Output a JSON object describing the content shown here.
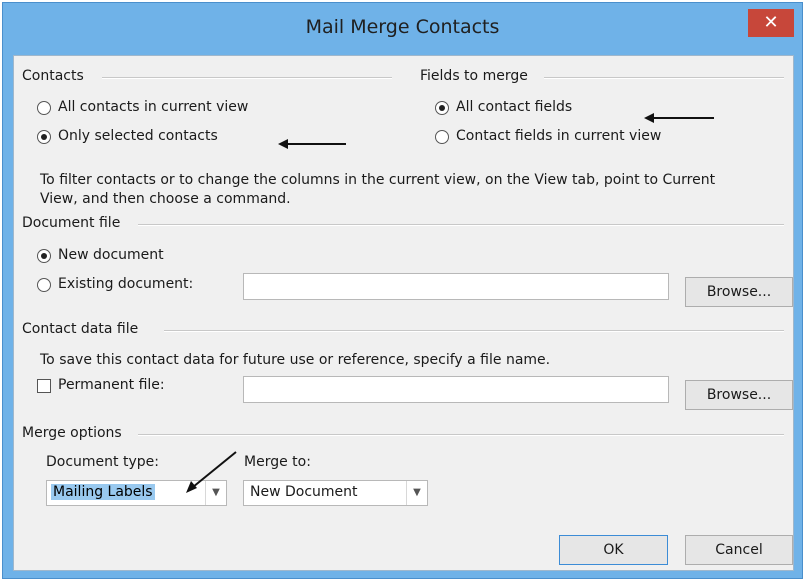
{
  "window": {
    "title": "Mail Merge Contacts",
    "close_label": "✕"
  },
  "contacts": {
    "label": "Contacts",
    "option_all": "All contacts in current view",
    "option_selected": "Only selected contacts",
    "selected": "selected"
  },
  "fields": {
    "label": "Fields to merge",
    "option_all": "All contact fields",
    "option_current": "Contact fields in current view",
    "selected": "all"
  },
  "help_text": {
    "line1": "To filter contacts or to change the columns in the current view, on the View tab, point to Current",
    "line2": "View, and then choose a command."
  },
  "document_file": {
    "label": "Document file",
    "option_new": "New document",
    "option_existing": "Existing document:",
    "existing_value": "",
    "browse_label": "Browse...",
    "selected": "new"
  },
  "contact_data_file": {
    "label": "Contact data file",
    "description": "To save this contact data for future use or reference, specify a file name.",
    "permanent_label": "Permanent file:",
    "permanent_checked": false,
    "file_value": "",
    "browse_label": "Browse..."
  },
  "merge_options": {
    "label": "Merge options",
    "document_type_label": "Document type:",
    "document_type_value": "Mailing Labels",
    "merge_to_label": "Merge to:",
    "merge_to_value": "New Document"
  },
  "buttons": {
    "ok": "OK",
    "cancel": "Cancel"
  },
  "colors": {
    "title_bar": "#6fb2e8",
    "close_button": "#c7473a",
    "selection": "#99c9ef"
  }
}
